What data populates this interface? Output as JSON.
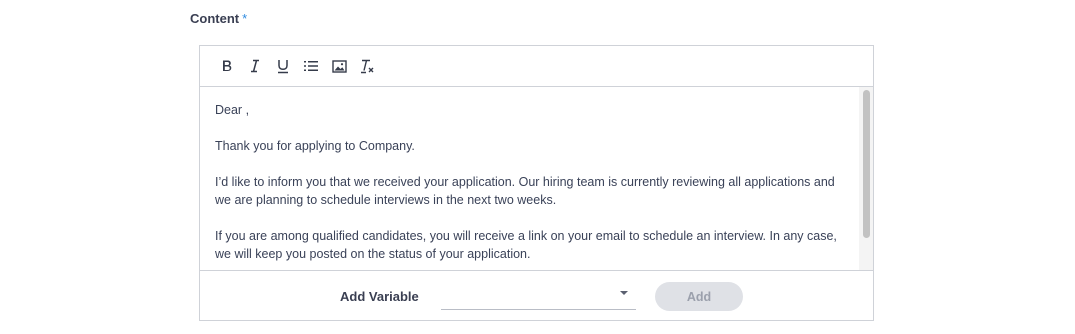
{
  "field": {
    "label": "Content",
    "required_marker": "*"
  },
  "toolbar": {
    "tools": [
      "bold-icon",
      "italic-icon",
      "underline-icon",
      "bulleted-list-icon",
      "image-icon",
      "clear-formatting-icon"
    ]
  },
  "editor": {
    "paragraphs": [
      "Dear ,",
      "Thank you for applying to Company.",
      "I’d like to inform you that we received your application. Our hiring team is currently reviewing all applications and we are planning to schedule interviews in the next two weeks.",
      "If you are among qualified candidates, you will receive a link on your email to schedule an interview. In any case, we will keep you posted on the status of your application."
    ]
  },
  "variable": {
    "label": "Add Variable",
    "selected_value": "",
    "add_button_label": "Add"
  },
  "colors": {
    "required_star": "#2f8be0",
    "button_disabled_bg": "#dfe1e6",
    "button_disabled_text": "#9ba0ac"
  }
}
